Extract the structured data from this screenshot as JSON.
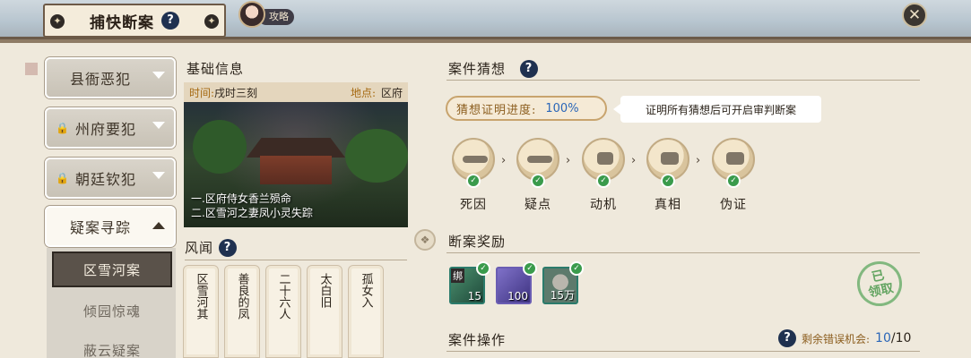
{
  "header": {
    "title": "捕快断案",
    "help_icon": "?",
    "guide_label": "攻略",
    "close_icon": "✕"
  },
  "nav": {
    "items": [
      {
        "label": "县衙恶犯",
        "locked": false
      },
      {
        "label": "州府要犯",
        "locked": true
      },
      {
        "label": "朝廷钦犯",
        "locked": true
      },
      {
        "label": "疑案寻踪",
        "locked": false,
        "open": true
      }
    ],
    "sub_items": [
      {
        "label": "区雪河案",
        "active": true
      },
      {
        "label": "倾园惊魂",
        "active": false
      },
      {
        "label": "蔽云疑案",
        "active": false
      }
    ]
  },
  "basic_info": {
    "heading": "基础信息",
    "time_label": "时间:",
    "time_value": "戌时三刻",
    "place_label": "地点:",
    "place_value": "区府",
    "caption_line1": "一.区府侍女香兰殒命",
    "caption_line2": "二.区雪河之妻凤小灵失踪"
  },
  "rumors": {
    "heading": "风闻",
    "cards": [
      "区雪河其",
      "善良的凤",
      "二十六人",
      "太白旧",
      "孤女入"
    ]
  },
  "hypothesis": {
    "heading": "案件猜想",
    "progress_label": "猜想证明进度:",
    "progress_value": "100%",
    "tip": "证明所有猜想后可开启审判断案",
    "clues": [
      {
        "name": "死因",
        "proven": true
      },
      {
        "name": "疑点",
        "proven": true
      },
      {
        "name": "动机",
        "proven": true
      },
      {
        "name": "真相",
        "proven": true
      },
      {
        "name": "伪证",
        "proven": true
      }
    ]
  },
  "rewards": {
    "heading": "断案奖励",
    "items": [
      {
        "icon": "jade-token-icon",
        "count": "15",
        "bound": "绑",
        "color": "#2f6f5a"
      },
      {
        "icon": "scroll-card-icon",
        "count": "100",
        "bound": "",
        "color": "#5a4e9a"
      },
      {
        "icon": "copper-coin-icon",
        "count": "15万",
        "bound": "",
        "color": "#4a6a5a"
      }
    ],
    "claimed_line1": "已",
    "claimed_line2": "领取"
  },
  "operations": {
    "heading": "案件操作",
    "chances_label": "剩余错误机会:",
    "chances_left": "10",
    "chances_total": "/10"
  }
}
